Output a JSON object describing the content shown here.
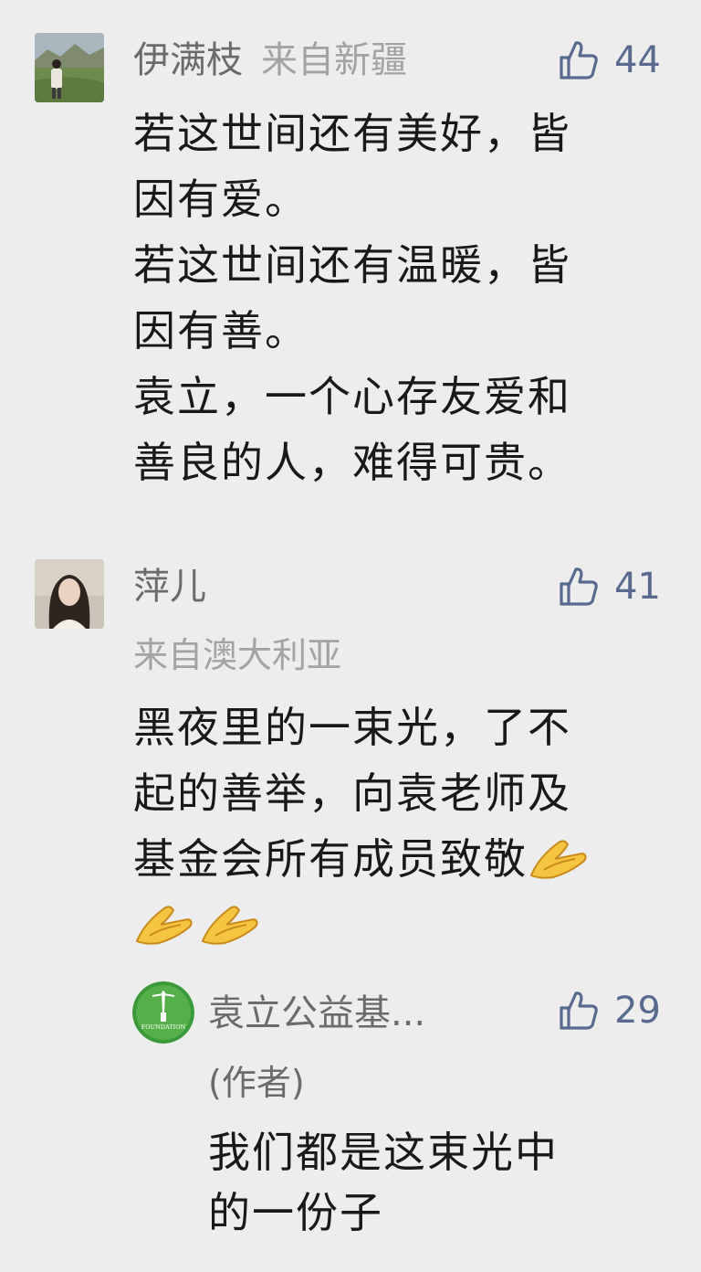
{
  "comments": [
    {
      "user": "伊满枝",
      "location": "来自新疆",
      "likes": "44",
      "lines": [
        "若这世间还有美好，皆",
        "因有爱。",
        "若这世间还有温暖，皆",
        "因有善。",
        "袁立，一个心存友爱和",
        "善良的人，难得可贵。"
      ]
    },
    {
      "user": "萍儿",
      "location": "来自澳大利亚",
      "likes": "41",
      "lines": [
        "黑夜里的一束光，了不",
        "起的善举，向袁老师及",
        "基金会所有成员致敬"
      ],
      "emoji": "folded-hands"
    }
  ],
  "reply": {
    "user": "袁立公益基...",
    "author_tag": "(作者)",
    "likes": "29",
    "avatar_text": "FOUNDATION",
    "lines": [
      "我们都是这束光中",
      "的一份子"
    ]
  },
  "colors": {
    "background": "#ededed",
    "name": "#6b6b6b",
    "location": "#a3a3a3",
    "like": "#5a6a8f",
    "text": "#191919"
  }
}
